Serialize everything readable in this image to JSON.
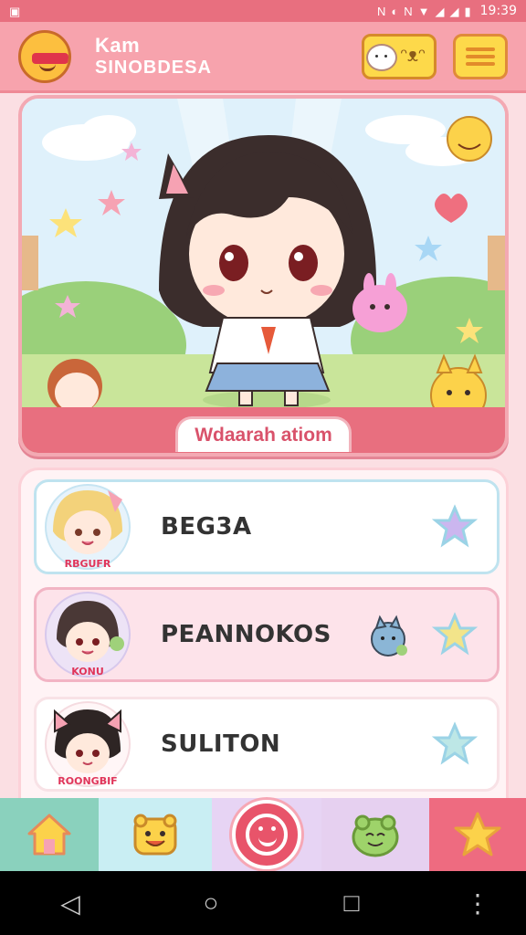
{
  "status_bar": {
    "time": "19:39",
    "icons": [
      "image-icon",
      "nfc-icon",
      "vibrate-icon",
      "no-sim-icon",
      "wifi-icon",
      "signal-icon",
      "signal-icon-2",
      "battery-icon"
    ]
  },
  "header": {
    "title_line1": "Kam",
    "title_line2": "SINOBDESA",
    "avatar_icon": "sunglasses-emoji-icon",
    "pet_button_icon": "pet-sticker-icon",
    "menu_button_icon": "menu-card-icon"
  },
  "hero": {
    "caption": "Wdaarah atiom",
    "colors": {
      "sky": "#dff1fb",
      "grass": "#c9e59a",
      "caption_bg": "#e86f7f"
    }
  },
  "list": {
    "items": [
      {
        "name": "BEG3A",
        "avatar_label": "RBGUFR",
        "star_color": "#cbb6ef"
      },
      {
        "name": "PEANNOKOS",
        "avatar_label": "KONU",
        "star_color": "#f2e48a"
      },
      {
        "name": "SULITON",
        "avatar_label": "ROONGBIF",
        "star_color": "#bde7e6"
      }
    ]
  },
  "bottom_nav": {
    "items": [
      "home-icon",
      "yellow-face-icon",
      "smiley-center-icon",
      "green-frog-icon",
      "star-icon"
    ]
  },
  "system_nav": {
    "back": "◁",
    "home": "○",
    "recents": "□",
    "more": "⋮"
  }
}
